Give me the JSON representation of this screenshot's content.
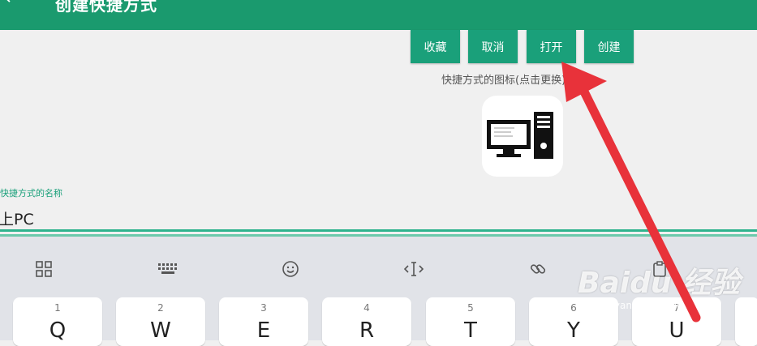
{
  "header": {
    "back_icon": "back-arrow-icon",
    "title": "创建快捷方式"
  },
  "actions": {
    "favorite": "收藏",
    "cancel": "取消",
    "open": "打开",
    "create": "创建"
  },
  "icon_hint": "快捷方式的图标(点击更换)",
  "shortcut": {
    "icon": "computer-icon",
    "name_label": "快捷方式的名称",
    "name_value": "上PC"
  },
  "keyboard": {
    "toolbar": [
      "grid-icon",
      "keypad-icon",
      "emoji-icon",
      "cursor-icon",
      "link-icon",
      "clipboard-icon"
    ],
    "keys": [
      {
        "num": "1",
        "letter": "Q"
      },
      {
        "num": "2",
        "letter": "W"
      },
      {
        "num": "3",
        "letter": "E"
      },
      {
        "num": "4",
        "letter": "R"
      },
      {
        "num": "5",
        "letter": "T"
      },
      {
        "num": "6",
        "letter": "Y"
      },
      {
        "num": "7",
        "letter": "U"
      }
    ]
  },
  "watermark": {
    "brand": "Baidu 经验",
    "url": "jingyan.baidu.com"
  },
  "colors": {
    "accent": "#1aa07a",
    "arrow": "#e8323a"
  }
}
